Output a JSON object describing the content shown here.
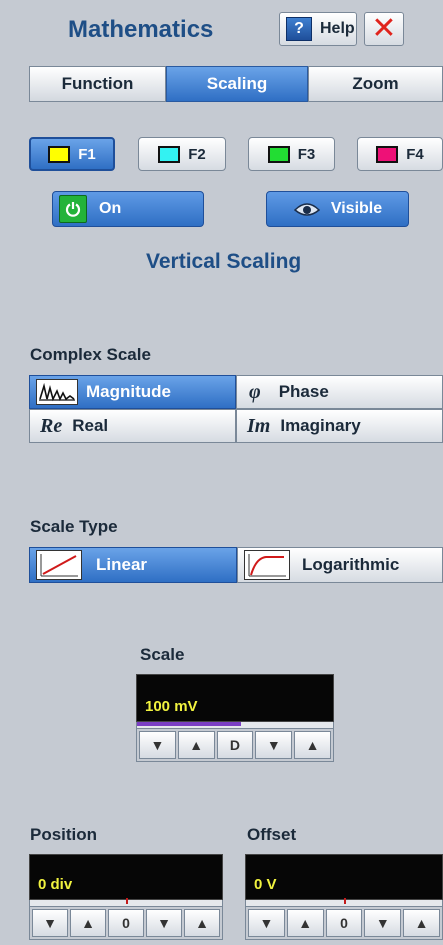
{
  "header": {
    "title": "Mathematics",
    "help_label": "Help",
    "help_icon": "?",
    "close_icon": "✕"
  },
  "tabs": [
    {
      "label": "Function",
      "active": false
    },
    {
      "label": "Scaling",
      "active": true
    },
    {
      "label": "Zoom",
      "active": false
    }
  ],
  "functions": [
    {
      "label": "F1",
      "color": "#ffff00",
      "active": true
    },
    {
      "label": "F2",
      "color": "#33f2f2",
      "active": false
    },
    {
      "label": "F3",
      "color": "#22dd33",
      "active": false
    },
    {
      "label": "F4",
      "color": "#ee1177",
      "active": false
    }
  ],
  "on_button": {
    "label": "On",
    "icon": "power-icon"
  },
  "visible_button": {
    "label": "Visible",
    "icon": "eye-icon"
  },
  "section_title": "Vertical Scaling",
  "complex_scale": {
    "label": "Complex Scale",
    "options": [
      {
        "label": "Magnitude",
        "icon": "magnitude-icon",
        "active": true
      },
      {
        "label": "Phase",
        "icon_text": "φ",
        "active": false
      },
      {
        "label": "Real",
        "icon_text": "Re",
        "active": false
      },
      {
        "label": "Imaginary",
        "icon_text": "Im",
        "active": false
      }
    ]
  },
  "scale_type": {
    "label": "Scale Type",
    "options": [
      {
        "label": "Linear",
        "icon": "linear-icon",
        "active": true
      },
      {
        "label": "Logarithmic",
        "icon": "log-icon",
        "active": false
      }
    ]
  },
  "scale": {
    "label": "Scale",
    "value": "100 mV",
    "level": 0.53,
    "buttons": [
      "▼",
      "▲",
      "D",
      "▼",
      "▲"
    ]
  },
  "position": {
    "label": "Position",
    "value": "0 div",
    "buttons": [
      "▼",
      "▲",
      "0",
      "▼",
      "▲"
    ]
  },
  "offset": {
    "label": "Offset",
    "value": "0 V",
    "buttons": [
      "▼",
      "▲",
      "0",
      "▼",
      "▲"
    ]
  },
  "colors": {
    "accent": "#2f6fc4",
    "title": "#1e4e86",
    "background": "#c5cad2",
    "readout_text": "#f1f33f"
  }
}
